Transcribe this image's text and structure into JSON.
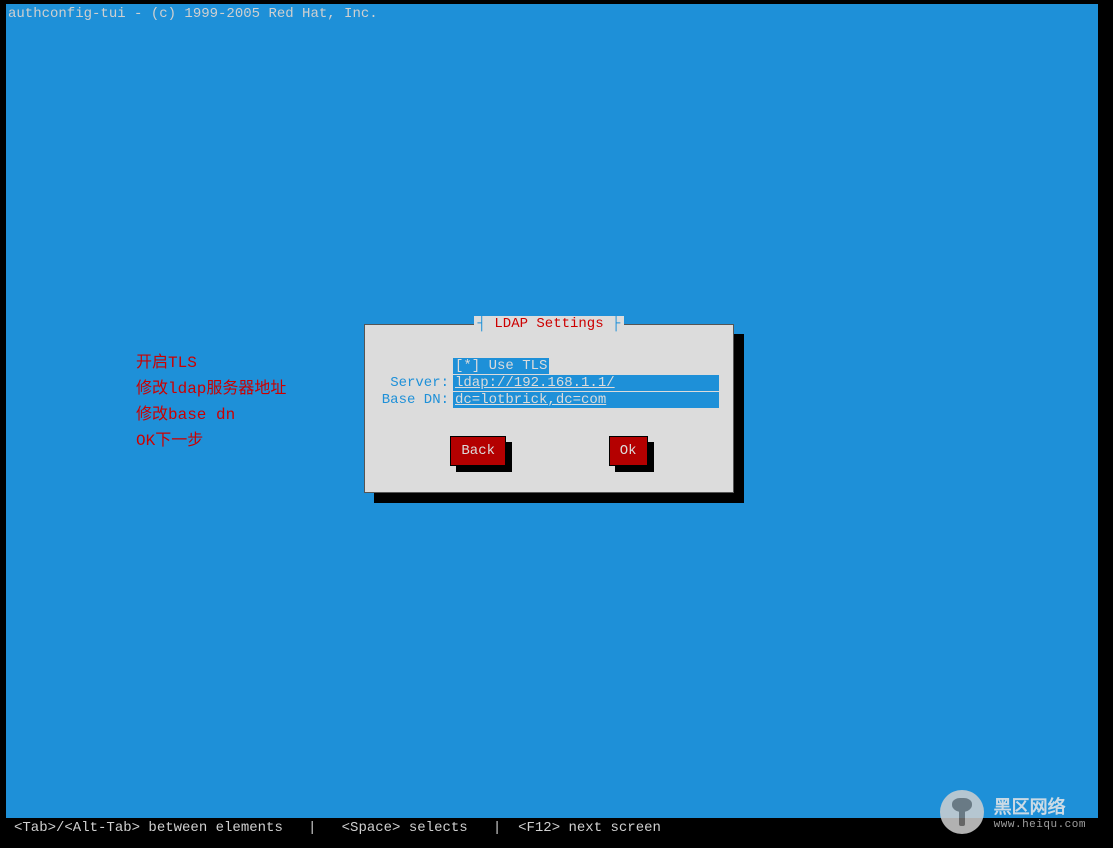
{
  "title": "authconfig-tui - (c) 1999-2005 Red Hat, Inc.",
  "annotations": {
    "l1": "开启TLS",
    "l2": "修改ldap服务器地址",
    "l3": "修改base dn",
    "l4": "OK下一步"
  },
  "dialog": {
    "title": "LDAP Settings",
    "use_tls_label": "[*] Use TLS",
    "server_label": "Server:",
    "server_value": "ldap://192.168.1.1/",
    "basedn_label": "Base DN:",
    "basedn_value": "dc=lotbrick,dc=com",
    "back": "Back",
    "ok": "Ok"
  },
  "footer": "<Tab>/<Alt-Tab> between elements   |   <Space> selects   |  <F12> next screen",
  "watermark": {
    "line1": "黑区网络",
    "line2": "www.heiqu.com"
  }
}
